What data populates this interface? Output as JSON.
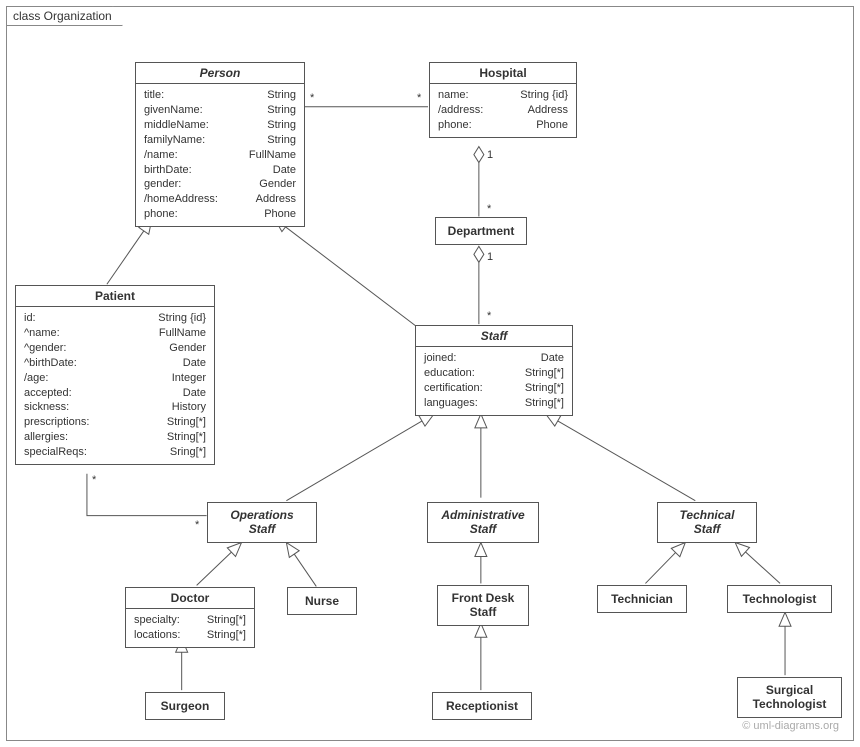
{
  "frame": {
    "title": "class Organization"
  },
  "classes": {
    "person": {
      "name": "Person",
      "attrs": [
        {
          "n": "title:",
          "t": "String"
        },
        {
          "n": "givenName:",
          "t": "String"
        },
        {
          "n": "middleName:",
          "t": "String"
        },
        {
          "n": "familyName:",
          "t": "String"
        },
        {
          "n": "/name:",
          "t": "FullName"
        },
        {
          "n": "birthDate:",
          "t": "Date"
        },
        {
          "n": "gender:",
          "t": "Gender"
        },
        {
          "n": "/homeAddress:",
          "t": "Address"
        },
        {
          "n": "phone:",
          "t": "Phone"
        }
      ]
    },
    "hospital": {
      "name": "Hospital",
      "attrs": [
        {
          "n": "name:",
          "t": "String {id}"
        },
        {
          "n": "/address:",
          "t": "Address"
        },
        {
          "n": "phone:",
          "t": "Phone"
        }
      ]
    },
    "department": {
      "name": "Department"
    },
    "patient": {
      "name": "Patient",
      "attrs": [
        {
          "n": "id:",
          "t": "String {id}"
        },
        {
          "n": "^name:",
          "t": "FullName"
        },
        {
          "n": "^gender:",
          "t": "Gender"
        },
        {
          "n": "^birthDate:",
          "t": "Date"
        },
        {
          "n": "/age:",
          "t": "Integer"
        },
        {
          "n": "accepted:",
          "t": "Date"
        },
        {
          "n": "sickness:",
          "t": "History"
        },
        {
          "n": "prescriptions:",
          "t": "String[*]"
        },
        {
          "n": "allergies:",
          "t": "String[*]"
        },
        {
          "n": "specialReqs:",
          "t": "Sring[*]"
        }
      ]
    },
    "staff": {
      "name": "Staff",
      "attrs": [
        {
          "n": "joined:",
          "t": "Date"
        },
        {
          "n": "education:",
          "t": "String[*]"
        },
        {
          "n": "certification:",
          "t": "String[*]"
        },
        {
          "n": "languages:",
          "t": "String[*]"
        }
      ]
    },
    "operationsStaff": {
      "name": "Operations\nStaff"
    },
    "administrativeStaff": {
      "name": "Administrative\nStaff"
    },
    "technicalStaff": {
      "name": "Technical\nStaff"
    },
    "doctor": {
      "name": "Doctor",
      "attrs": [
        {
          "n": "specialty:",
          "t": "String[*]"
        },
        {
          "n": "locations:",
          "t": "String[*]"
        }
      ]
    },
    "nurse": {
      "name": "Nurse"
    },
    "frontDeskStaff": {
      "name": "Front Desk\nStaff"
    },
    "technician": {
      "name": "Technician"
    },
    "technologist": {
      "name": "Technologist"
    },
    "surgeon": {
      "name": "Surgeon"
    },
    "receptionist": {
      "name": "Receptionist"
    },
    "surgicalTechnologist": {
      "name": "Surgical\nTechnologist"
    }
  },
  "mult": {
    "person_hosp_left": "*",
    "person_hosp_right": "*",
    "hosp_dept_top": "1",
    "hosp_dept_bottom": "*",
    "dept_staff_top": "1",
    "dept_staff_bottom": "*",
    "patient_ops_left": "*",
    "patient_ops_right": "*"
  },
  "credit": "© uml-diagrams.org"
}
